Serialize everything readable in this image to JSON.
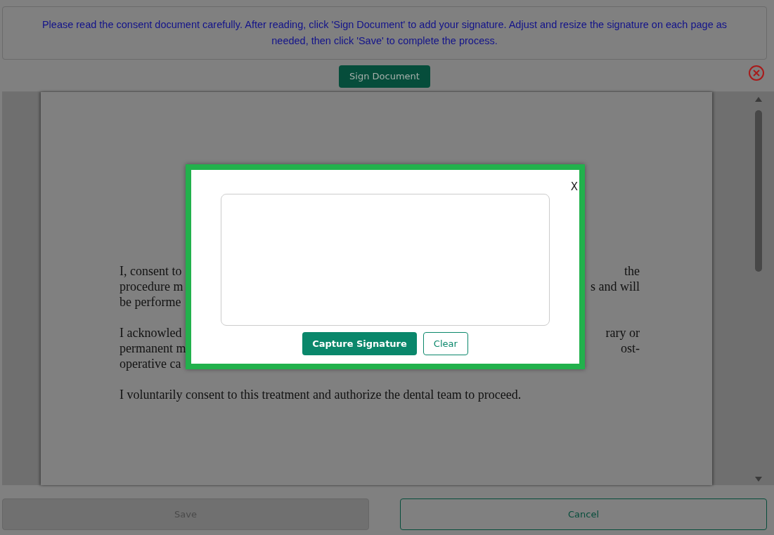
{
  "instructions": "Please read the consent document carefully. After reading, click 'Sign Document' to add your signature. Adjust and resize the signature on each page as needed, then click 'Save' to complete the process.",
  "sign_button": "Sign Document",
  "document": {
    "paragraphs": [
      {
        "lines": [
          {
            "left": "I, consent to",
            "right": "the"
          },
          {
            "left": "procedure m",
            "right": "s and will"
          },
          {
            "left": "be performe"
          }
        ]
      },
      {
        "lines": [
          {
            "left": "I acknowled",
            "right": "rary or"
          },
          {
            "left": "permanent m",
            "right": "ost-"
          },
          {
            "left": "operative ca"
          }
        ]
      },
      {
        "lines": [
          {
            "left": "I voluntarily consent to this treatment and authorize the dental team to proceed."
          }
        ]
      }
    ]
  },
  "dialog": {
    "close": "X",
    "buttons": [
      {
        "label": "Capture Signature",
        "kind": "primary"
      },
      {
        "label": "Clear",
        "kind": "outline"
      }
    ]
  },
  "footer": {
    "buttons": [
      {
        "label": "Save",
        "disabled": true
      },
      {
        "label": "Cancel",
        "disabled": false
      }
    ]
  }
}
